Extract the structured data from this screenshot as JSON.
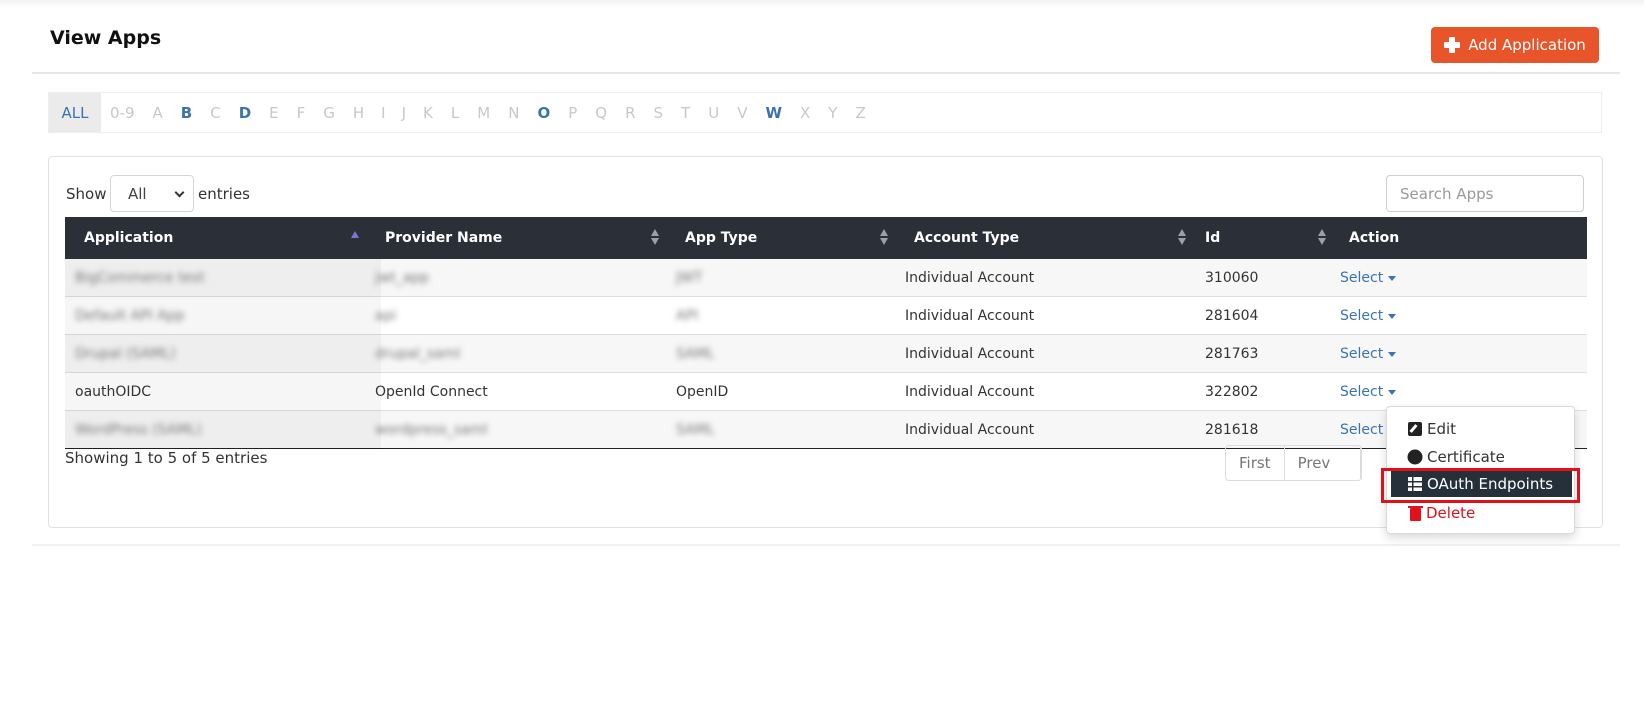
{
  "header": {
    "title": "View Apps",
    "add_button_label": "Add Application",
    "accent_color": "#e8552a"
  },
  "alphabet_filter": {
    "items": [
      {
        "label": "ALL",
        "state": "active"
      },
      {
        "label": "0-9",
        "state": "empty"
      },
      {
        "label": "A",
        "state": "empty"
      },
      {
        "label": "B",
        "state": "has"
      },
      {
        "label": "C",
        "state": "empty"
      },
      {
        "label": "D",
        "state": "has"
      },
      {
        "label": "E",
        "state": "empty"
      },
      {
        "label": "F",
        "state": "empty"
      },
      {
        "label": "G",
        "state": "empty"
      },
      {
        "label": "H",
        "state": "empty"
      },
      {
        "label": "I",
        "state": "empty"
      },
      {
        "label": "J",
        "state": "empty"
      },
      {
        "label": "K",
        "state": "empty"
      },
      {
        "label": "L",
        "state": "empty"
      },
      {
        "label": "M",
        "state": "empty"
      },
      {
        "label": "N",
        "state": "empty"
      },
      {
        "label": "O",
        "state": "has"
      },
      {
        "label": "P",
        "state": "empty"
      },
      {
        "label": "Q",
        "state": "empty"
      },
      {
        "label": "R",
        "state": "empty"
      },
      {
        "label": "S",
        "state": "empty"
      },
      {
        "label": "T",
        "state": "empty"
      },
      {
        "label": "U",
        "state": "empty"
      },
      {
        "label": "V",
        "state": "empty"
      },
      {
        "label": "W",
        "state": "has"
      },
      {
        "label": "X",
        "state": "empty"
      },
      {
        "label": "Y",
        "state": "empty"
      },
      {
        "label": "Z",
        "state": "empty"
      }
    ]
  },
  "table_controls": {
    "show_label": "Show",
    "page_size_value": "All",
    "entries_label": "entries",
    "search_placeholder": "Search Apps"
  },
  "table": {
    "columns": [
      {
        "label": "Application",
        "sort": "asc"
      },
      {
        "label": "Provider Name",
        "sort": "both"
      },
      {
        "label": "App Type",
        "sort": "both"
      },
      {
        "label": "Account Type",
        "sort": "both"
      },
      {
        "label": "Id",
        "sort": "both"
      },
      {
        "label": "Action",
        "sort": "none"
      }
    ],
    "rows": [
      {
        "application": "BigCommerce test",
        "provider": "jwt_app",
        "app_type": "JWT",
        "account_type": "Individual Account",
        "id": "310060",
        "action": "Select",
        "redacted": true
      },
      {
        "application": "Default API App",
        "provider": "api",
        "app_type": "API",
        "account_type": "Individual Account",
        "id": "281604",
        "action": "Select",
        "redacted": true
      },
      {
        "application": "Drupal (SAML)",
        "provider": "drupal_saml",
        "app_type": "SAML",
        "account_type": "Individual Account",
        "id": "281763",
        "action": "Select",
        "redacted": true
      },
      {
        "application": "oauthOIDC",
        "provider": "OpenId Connect",
        "app_type": "OpenID",
        "account_type": "Individual Account",
        "id": "322802",
        "action": "Select",
        "redacted": false
      },
      {
        "application": "WordPress (SAML)",
        "provider": "wordpress_saml",
        "app_type": "SAML",
        "account_type": "Individual Account",
        "id": "281618",
        "action": "Select",
        "redacted": true
      }
    ]
  },
  "footer": {
    "showing_text": "Showing 1 to 5 of 5 entries",
    "pager": [
      "First",
      "Prev"
    ]
  },
  "action_menu": {
    "items": [
      {
        "label": "Edit",
        "icon": "edit-icon"
      },
      {
        "label": "Certificate",
        "icon": "certificate-icon"
      },
      {
        "label": "OAuth Endpoints",
        "icon": "table-icon",
        "highlighted": true
      },
      {
        "label": "Delete",
        "icon": "trash-icon",
        "danger": true
      }
    ],
    "highlight_color": "#e0101d"
  }
}
